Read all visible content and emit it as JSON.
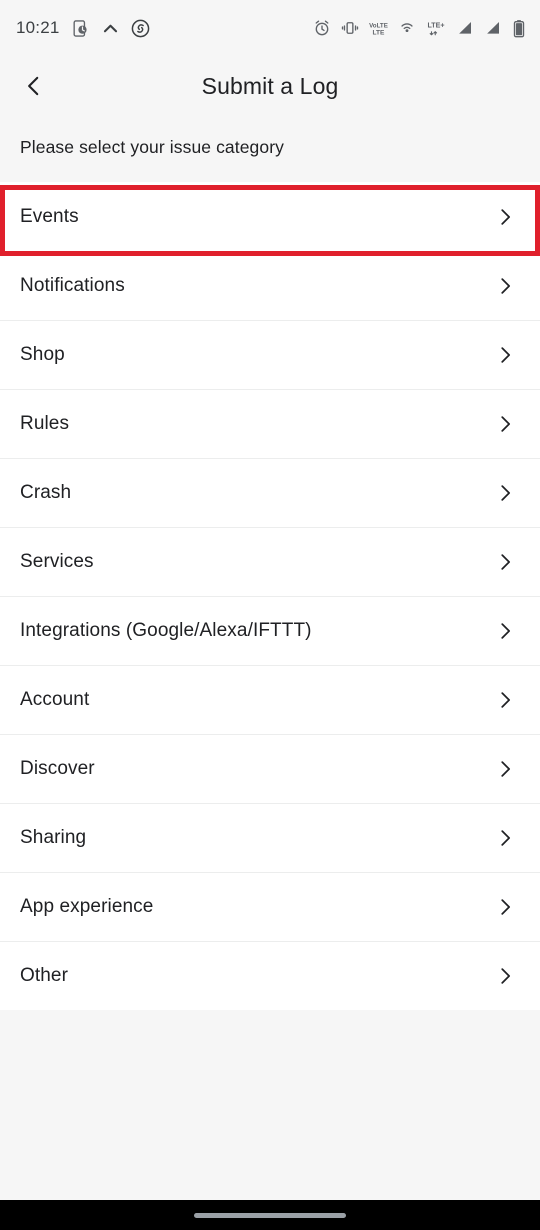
{
  "status_bar": {
    "time": "10:21",
    "left_icons": [
      {
        "name": "screenshot-icon",
        "label": "screenshot"
      },
      {
        "name": "chevron-up-icon",
        "label": "collapse"
      },
      {
        "name": "shazam-icon",
        "label": "shazam"
      }
    ],
    "right_icons": [
      {
        "name": "alarm-icon",
        "label": "alarm set"
      },
      {
        "name": "vibrate-icon",
        "label": "vibrate mode"
      },
      {
        "name": "volte-icon",
        "label": "VoLTE"
      },
      {
        "name": "cast-icon",
        "label": "cast"
      },
      {
        "name": "lte-plus-icon",
        "label": "LTE+"
      },
      {
        "name": "signal-sim1-icon",
        "label": "signal SIM 1"
      },
      {
        "name": "signal-sim2-icon",
        "label": "signal SIM 2"
      },
      {
        "name": "battery-icon",
        "label": "battery"
      }
    ]
  },
  "header": {
    "back_label": "Back",
    "title": "Submit a Log"
  },
  "subtitle": "Please select your issue category",
  "list": {
    "items": [
      {
        "label": "Events"
      },
      {
        "label": "Notifications"
      },
      {
        "label": "Shop"
      },
      {
        "label": "Rules"
      },
      {
        "label": "Crash"
      },
      {
        "label": "Services"
      },
      {
        "label": "Integrations (Google/Alexa/IFTTT)"
      },
      {
        "label": "Account"
      },
      {
        "label": "Discover"
      },
      {
        "label": "Sharing"
      },
      {
        "label": "App experience"
      },
      {
        "label": "Other"
      }
    ],
    "highlighted_index": 0
  },
  "colors": {
    "highlight": "#e0202c",
    "background": "#f6f6f6",
    "surface": "#ffffff",
    "text_primary": "#202124",
    "divider": "#eceded",
    "navbar": "#000000",
    "gesture_pill": "#9aa0a6"
  },
  "navbar": {
    "gesture_pill_label": "Home gesture bar"
  }
}
